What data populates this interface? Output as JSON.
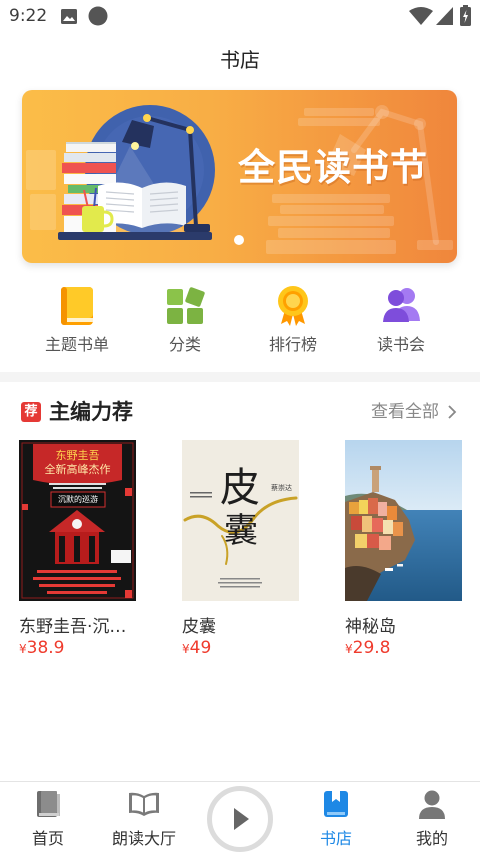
{
  "status_bar": {
    "time": "9:22",
    "icons": [
      "image-icon",
      "circle-icon",
      "wifi-icon",
      "signal-icon",
      "battery-charging-icon"
    ]
  },
  "header": {
    "title": "书店"
  },
  "banner": {
    "text": "全民读书节",
    "page_count": 1,
    "current_page": 1
  },
  "categories": [
    {
      "label": "主题书单",
      "icon": "book-list-icon"
    },
    {
      "label": "分类",
      "icon": "category-grid-icon"
    },
    {
      "label": "排行榜",
      "icon": "medal-icon"
    },
    {
      "label": "读书会",
      "icon": "people-icon"
    }
  ],
  "section": {
    "badge": "荐",
    "title": "主编力荐",
    "more_label": "查看全部",
    "more_icon": "chevron-right-icon"
  },
  "books": [
    {
      "title": "东野圭吾·沉…",
      "currency": "¥",
      "price": "38.9",
      "cover": {
        "line_1": "东野圭吾",
        "line_2": "全新高峰杰作",
        "cover_title": "沉默的巡游"
      }
    },
    {
      "title": "皮囊",
      "currency": "¥",
      "price": "49",
      "cover": {
        "char_1": "皮",
        "char_2": "囊",
        "author": "蔡崇达"
      }
    },
    {
      "title": "神秘岛",
      "currency": "¥",
      "price": "29.8",
      "cover": {}
    }
  ],
  "bottom_nav": {
    "items": [
      {
        "label": "首页",
        "icon": "home-book-icon",
        "active": false
      },
      {
        "label": "朗读大厅",
        "icon": "open-book-icon",
        "active": false
      },
      {
        "label": "书店",
        "icon": "bookstore-icon",
        "active": true
      },
      {
        "label": "我的",
        "icon": "person-icon",
        "active": false
      }
    ],
    "center_button_icon": "play-icon"
  },
  "colors": {
    "accent": "#1e88e5",
    "price": "#ef3b2d",
    "badge": "#e53935",
    "banner_start": "#fbbd48",
    "banner_end": "#f0863c"
  }
}
